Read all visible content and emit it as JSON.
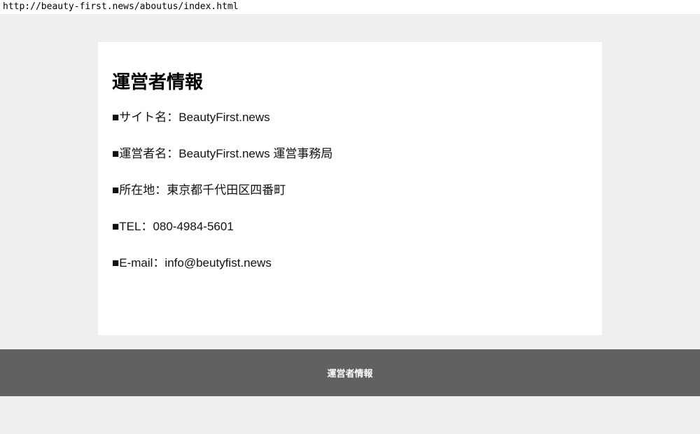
{
  "browser": {
    "url": "http://beauty-first.news/aboutus/index.html"
  },
  "main": {
    "title": "運営者情報",
    "items": [
      "■サイト名：BeautyFirst.news",
      "■運営者名：BeautyFirst.news 運営事務局",
      "■所在地：東京都千代田区四番町",
      "■TEL：080-4984-5601",
      "■E-mail：info@beutyfist.news"
    ]
  },
  "footer": {
    "link_label": "運営者情報"
  },
  "colors": {
    "page_background": "#efefef",
    "card_background": "#ffffff",
    "footer_background": "#616161",
    "footer_text": "#ffffff"
  }
}
